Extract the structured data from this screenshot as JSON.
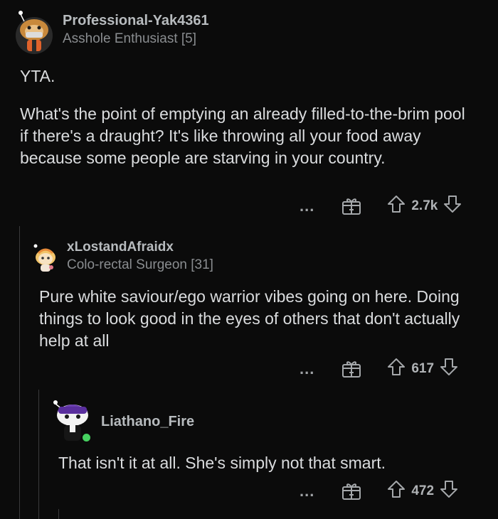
{
  "comments": [
    {
      "username": "Professional-Yak4361",
      "flair": "Asshole Enthusiast [5]",
      "paragraphs": [
        "YTA.",
        "What's the point of emptying an already filled-to-the-brim pool if there's a draught? It's like throwing all your food away because some people are starving in your country."
      ],
      "score": "2.7k",
      "more": "..."
    },
    {
      "username": "xLostandAfraidx",
      "flair": "Colo-rectal Surgeon [31]",
      "paragraphs": [
        "Pure white saviour/ego warrior vibes going on here. Doing things to look good in the eyes of others that don't actually help at all"
      ],
      "score": "617",
      "more": "..."
    },
    {
      "username": "Liathano_Fire",
      "flair": "",
      "paragraphs": [
        "That isn't it at all. She's simply not that smart."
      ],
      "score": "472",
      "more": "..."
    }
  ],
  "icons": {
    "more": "more-options-icon",
    "award": "award-gift-icon",
    "upvote": "upvote-arrow-icon",
    "downvote": "downvote-arrow-icon"
  },
  "colors": {
    "background": "#0b0b0b",
    "online": "#46d160",
    "thread_line": "#3a3a3c"
  }
}
